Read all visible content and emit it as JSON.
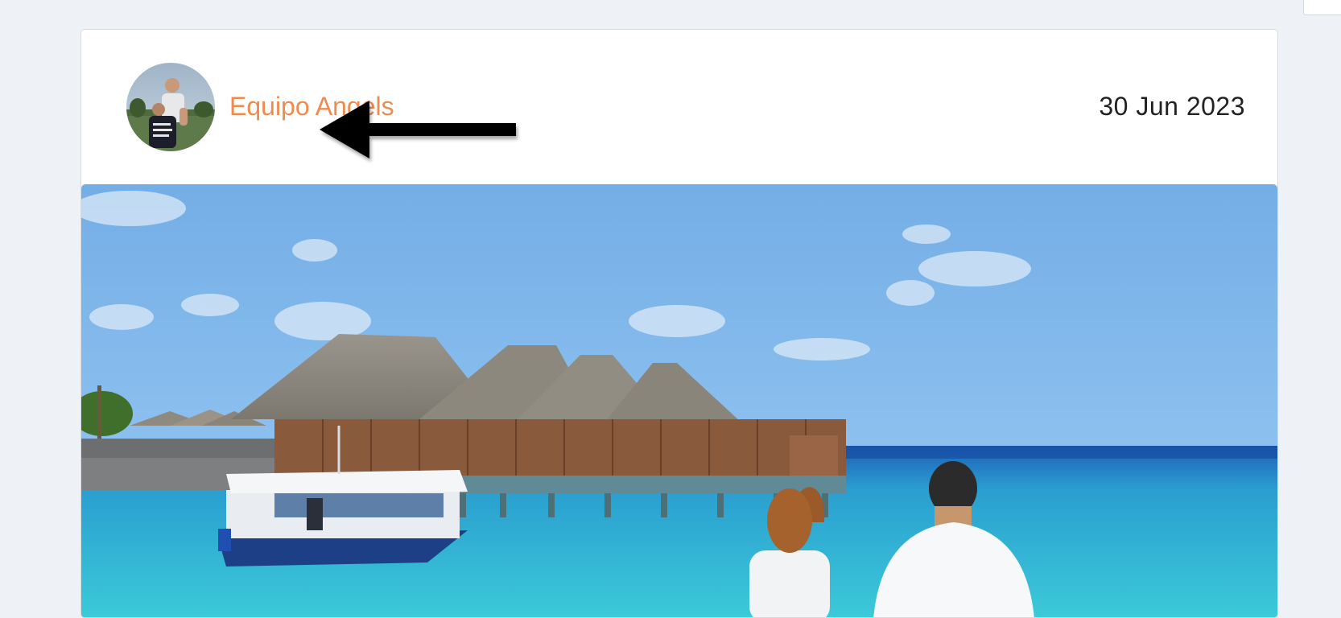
{
  "post": {
    "author_name": "Equipo Angels",
    "date": "30 Jun 2023",
    "avatar_icon": "user-photo-avatar",
    "image_description_icon": "beach-resort-photo"
  },
  "colors": {
    "page_background": "#eef2f6",
    "author_link": "#ee8c4f",
    "date_text": "#222222",
    "arrow": "#000000"
  }
}
